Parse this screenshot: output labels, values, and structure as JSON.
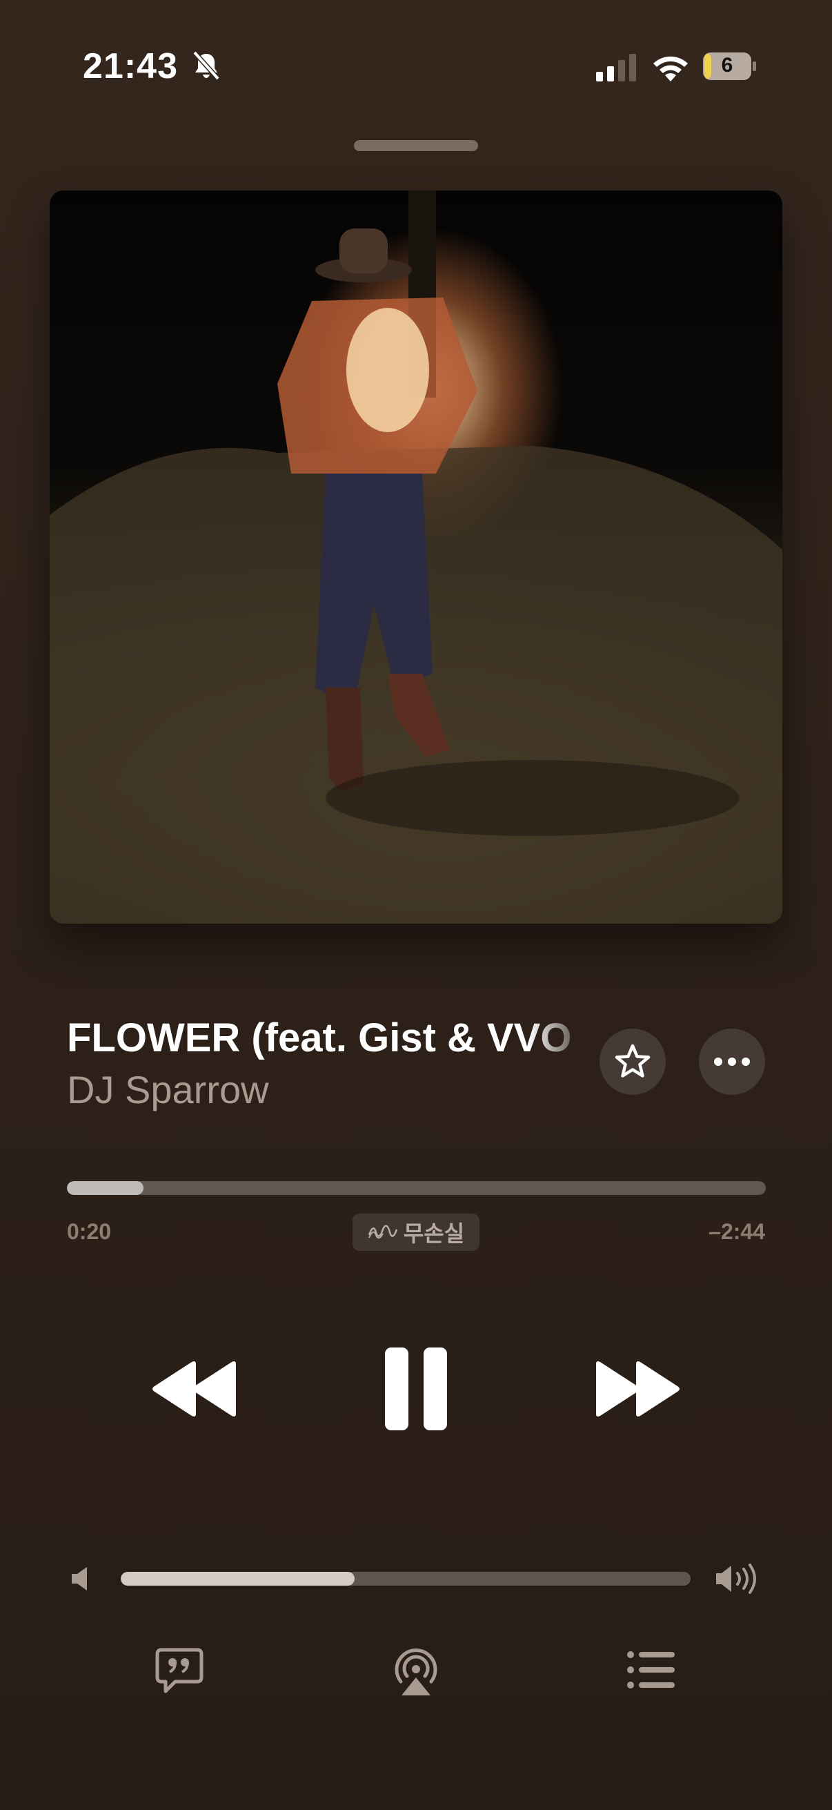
{
  "status_bar": {
    "time": "21:43",
    "battery_level": "6",
    "icons": [
      "bell-slash-icon",
      "cellular-signal-icon",
      "wifi-icon",
      "battery-icon"
    ]
  },
  "now_playing": {
    "title": "FLOWER (feat. Gist & VVO",
    "artist": "DJ Sparrow",
    "favorite_icon": "star-icon",
    "more_icon": "ellipsis-icon"
  },
  "progress": {
    "elapsed": "0:20",
    "remaining": "–2:44",
    "fraction": 0.11,
    "quality_badge": "무손실"
  },
  "transport": {
    "previous_icon": "backward-icon",
    "play_pause_icon": "pause-icon",
    "next_icon": "forward-icon"
  },
  "volume": {
    "level": 0.41,
    "low_icon": "speaker-low-icon",
    "high_icon": "speaker-high-icon"
  },
  "bottom_bar": {
    "lyrics_icon": "lyrics-quote-bubble-icon",
    "airplay_icon": "airplay-audio-icon",
    "queue_icon": "list-bullet-icon"
  },
  "colors": {
    "background": "#2f231b",
    "accent_text": "#ffffff",
    "secondary_text": "#a89b91"
  }
}
